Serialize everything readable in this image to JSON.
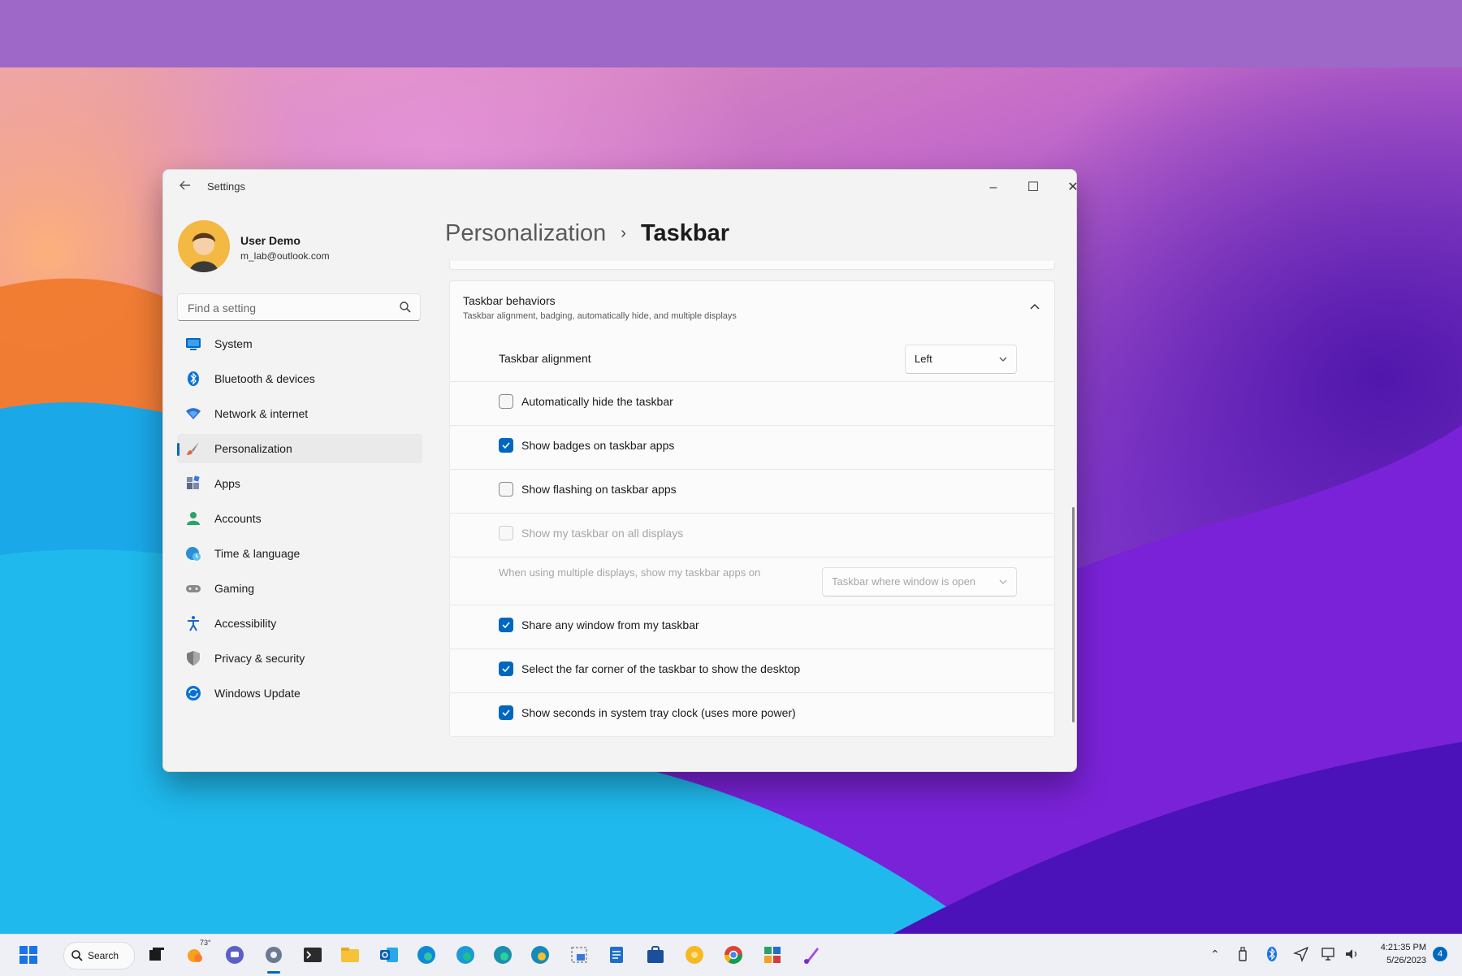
{
  "window": {
    "app_title": "Settings",
    "controls": {
      "minimize": "–",
      "maximize": "☐",
      "close": "✕"
    }
  },
  "profile": {
    "name": "User Demo",
    "email": "m_lab@outlook.com"
  },
  "search": {
    "placeholder": "Find a setting"
  },
  "nav": {
    "items": [
      {
        "label": "System",
        "icon": "monitor-icon",
        "color": "#0067c0"
      },
      {
        "label": "Bluetooth & devices",
        "icon": "bluetooth-icon",
        "color": "#0a72d6"
      },
      {
        "label": "Network & internet",
        "icon": "wifi-icon",
        "color": "#2b6fd6"
      },
      {
        "label": "Personalization",
        "icon": "brush-icon",
        "color": "#d86a3c",
        "selected": true
      },
      {
        "label": "Apps",
        "icon": "apps-icon",
        "color": "#5a6a86"
      },
      {
        "label": "Accounts",
        "icon": "person-icon",
        "color": "#2aa36b"
      },
      {
        "label": "Time & language",
        "icon": "globe-clock-icon",
        "color": "#2b8fd6"
      },
      {
        "label": "Gaming",
        "icon": "gamepad-icon",
        "color": "#8a8a8a"
      },
      {
        "label": "Accessibility",
        "icon": "accessibility-icon",
        "color": "#1a66c9"
      },
      {
        "label": "Privacy & security",
        "icon": "shield-icon",
        "color": "#7a7a7a"
      },
      {
        "label": "Windows Update",
        "icon": "update-icon",
        "color": "#0a72d6"
      }
    ]
  },
  "breadcrumb": {
    "parent": "Personalization",
    "separator": "›",
    "current": "Taskbar"
  },
  "behaviors": {
    "title": "Taskbar behaviors",
    "description": "Taskbar alignment, badging, automatically hide, and multiple displays",
    "alignment_label": "Taskbar alignment",
    "alignment_value": "Left",
    "options": [
      {
        "label": "Automatically hide the taskbar",
        "checked": false,
        "disabled": false
      },
      {
        "label": "Show badges on taskbar apps",
        "checked": true,
        "disabled": false
      },
      {
        "label": "Show flashing on taskbar apps",
        "checked": false,
        "disabled": false
      },
      {
        "label": "Show my taskbar on all displays",
        "checked": false,
        "disabled": true
      }
    ],
    "multi_display_label": "When using multiple displays, show my taskbar apps on",
    "multi_display_value": "Taskbar where window is open",
    "options2": [
      {
        "label": "Share any window from my taskbar",
        "checked": true
      },
      {
        "label": "Select the far corner of the taskbar to show the desktop",
        "checked": true
      },
      {
        "label": "Show seconds in system tray clock (uses more power)",
        "checked": true
      }
    ]
  },
  "taskbar": {
    "search_label": "Search",
    "weather_badge": "73°",
    "clock_time": "4:21:35 PM",
    "clock_date": "5/26/2023",
    "notification_count": "4"
  },
  "accent_color": "#0067c0"
}
